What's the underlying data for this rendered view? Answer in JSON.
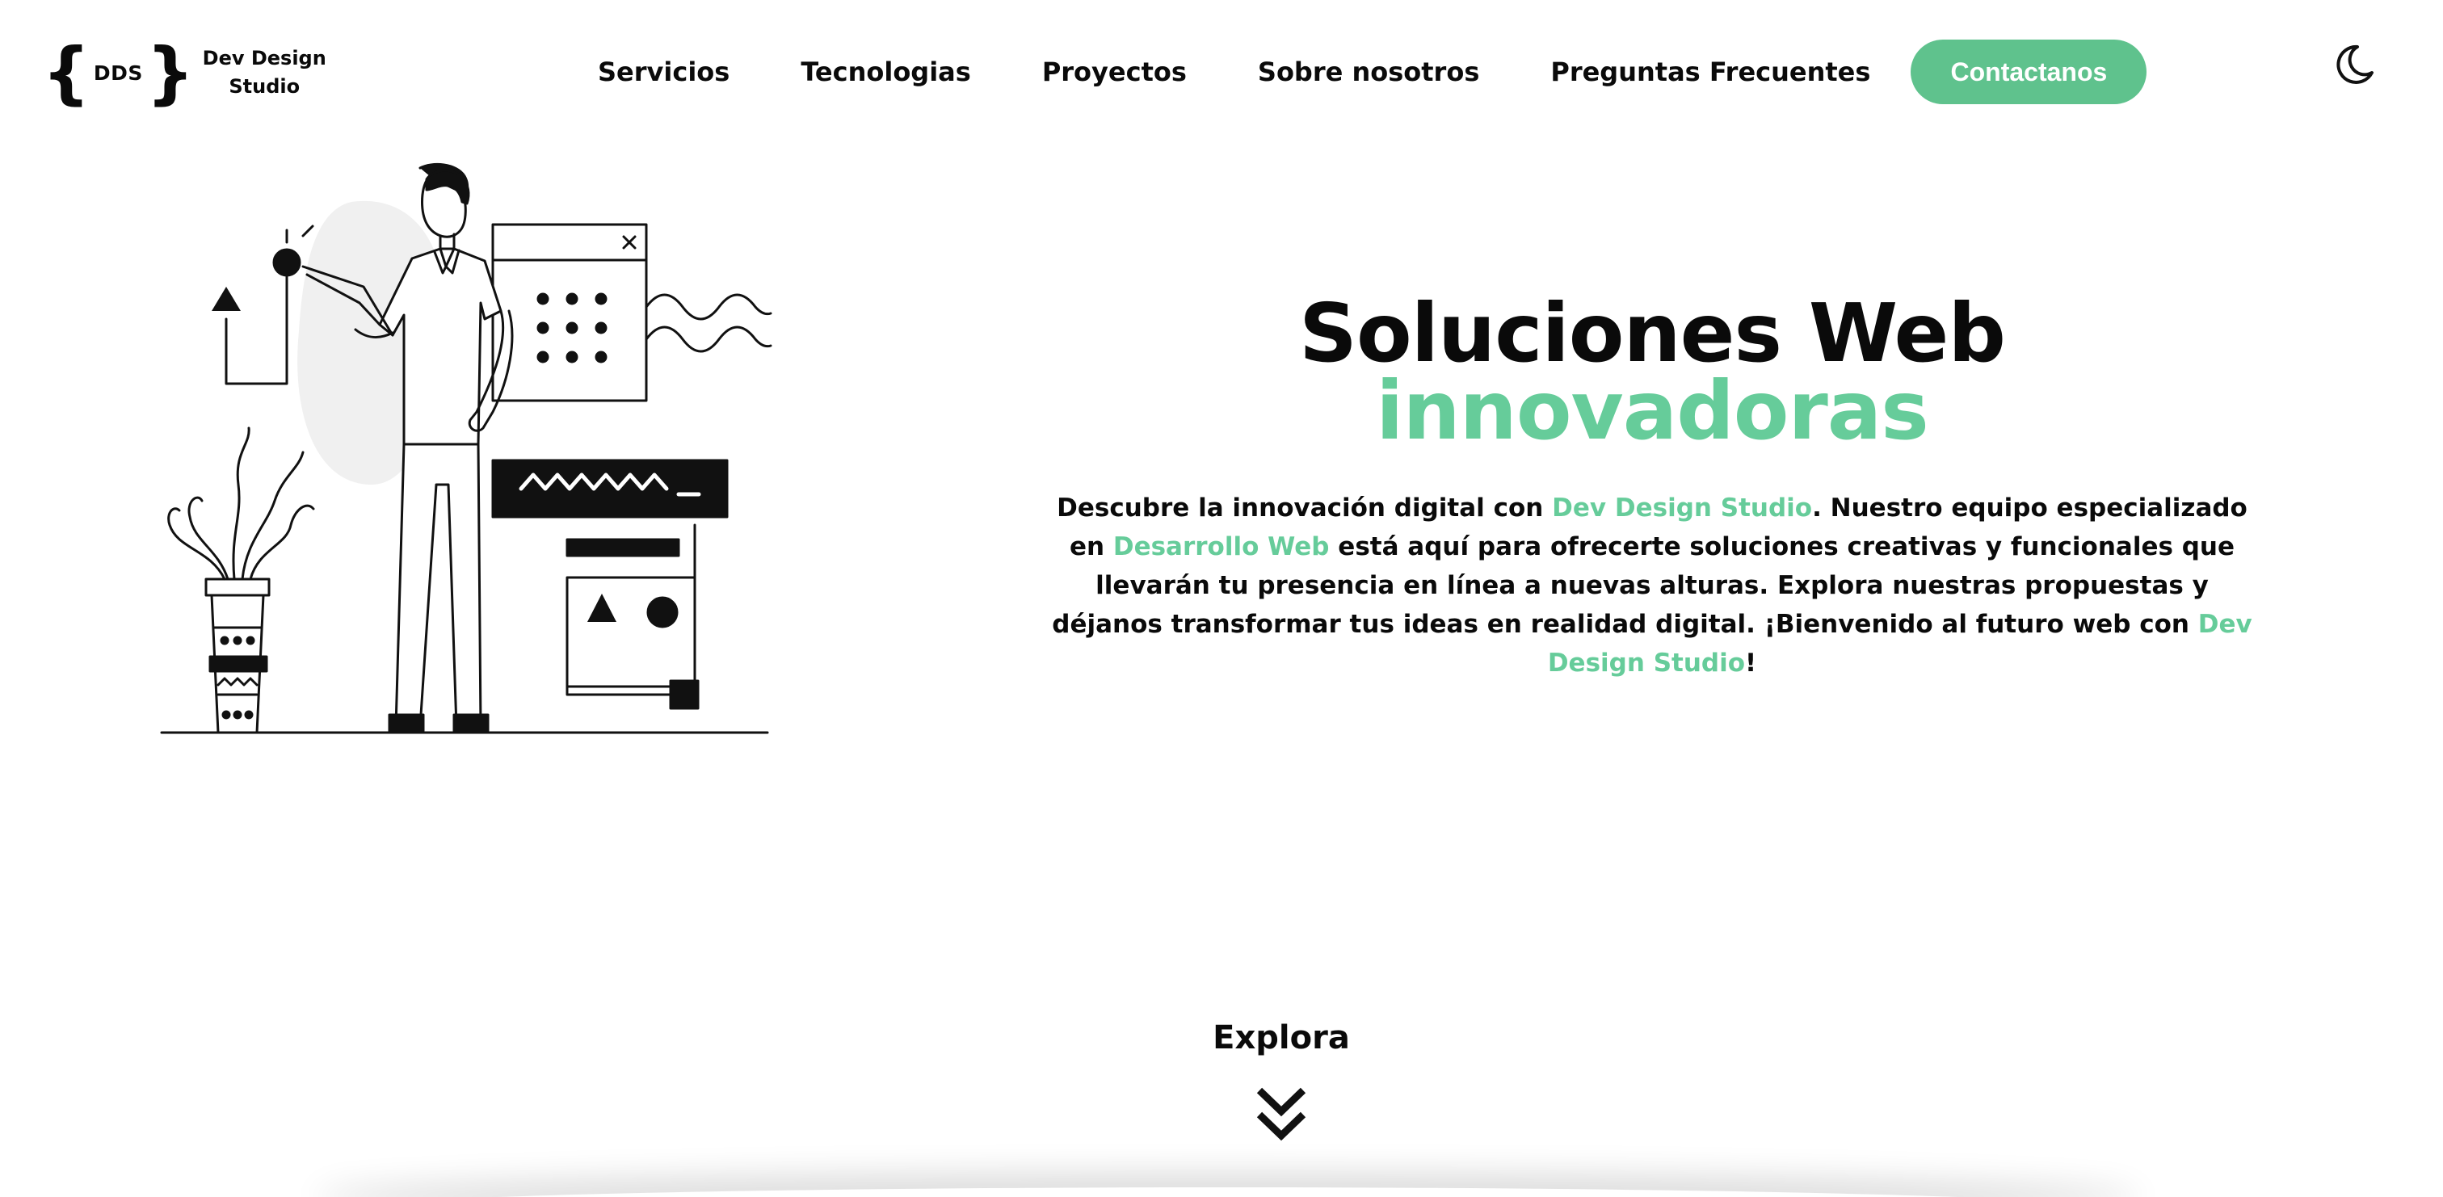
{
  "header": {
    "logo": {
      "brace_open": "{",
      "initials": "DDS",
      "brace_close": "}",
      "name_line1": "Dev Design",
      "name_line2": "Studio"
    },
    "nav": [
      {
        "label": "Servicios"
      },
      {
        "label": "Tecnologias"
      },
      {
        "label": "Proyectos"
      },
      {
        "label": "Sobre nosotros"
      },
      {
        "label": "Preguntas Frecuentes"
      }
    ],
    "cta_label": "Contactanos",
    "theme_toggle_icon": "moon-icon"
  },
  "hero": {
    "title_line1": "Soluciones Web",
    "title_line2": "innovadoras",
    "description": {
      "part1": "Descubre la innovación digital con ",
      "highlight1": "Dev Design Studio",
      "part2": ". Nuestro equipo especializado en ",
      "highlight2": "Desarrollo Web",
      "part3": " está aquí para ofrecerte soluciones creativas y funcionales que llevarán tu presencia en línea a nuevas alturas. Explora nuestras propuestas y déjanos transformar tus ideas en realidad digital. ¡Bienvenido al futuro web con ",
      "highlight3": "Dev Design Studio",
      "part4": "!"
    },
    "illustration_icon": "developer-illustration-icon"
  },
  "explore": {
    "label": "Explora",
    "icon": "double-chevron-down-icon"
  },
  "colors": {
    "accent": "#5fc28d",
    "highlight_text": "#66cc9a",
    "text": "#0a0a0a",
    "background": "#ffffff"
  }
}
